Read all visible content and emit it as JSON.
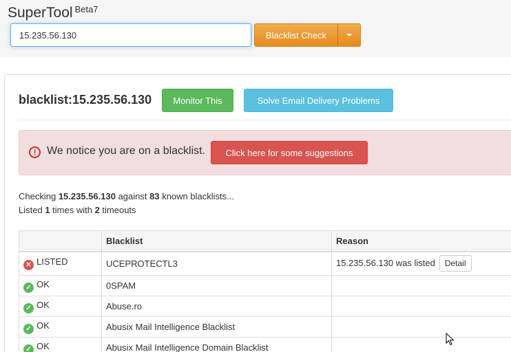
{
  "brand": {
    "name": "SuperTool",
    "badge": "Beta7"
  },
  "search": {
    "value": "15.235.56.130",
    "check_label": "Blacklist Check"
  },
  "heading": "blacklist:15.235.56.130",
  "buttons": {
    "monitor": "Monitor This",
    "solve": "Solve Email Delivery Problems"
  },
  "alert": {
    "icon": "exclamation-circle-icon",
    "text": "We notice you are on a blacklist.",
    "button": "Click here for some suggestions"
  },
  "summary": {
    "line1_pre": "Checking ",
    "ip": "15.235.56.130",
    "line1_mid": " against ",
    "count": "83",
    "line1_post": " known blacklists...",
    "line2_pre": "Listed ",
    "listed": "1",
    "line2_mid": " times with ",
    "timeouts": "2",
    "line2_post": " timeouts"
  },
  "table": {
    "headers": [
      "",
      "Blacklist",
      "Reason"
    ],
    "rows": [
      {
        "status": "LISTED",
        "blacklist": "UCEPROTECTL3",
        "reason": "15.235.56.130 was listed",
        "action": "Detail"
      },
      {
        "status": "OK",
        "blacklist": "0SPAM",
        "reason": ""
      },
      {
        "status": "OK",
        "blacklist": "Abuse.ro",
        "reason": ""
      },
      {
        "status": "OK",
        "blacklist": "Abusix Mail Intelligence Blacklist",
        "reason": ""
      },
      {
        "status": "OK",
        "blacklist": "Abusix Mail Intelligence Domain Blacklist",
        "reason": ""
      }
    ]
  },
  "colors": {
    "warning": "#f0ad4e",
    "success": "#5cb85c",
    "info": "#5bc0de",
    "danger": "#d9534f",
    "alert_bg": "#f2dede"
  }
}
